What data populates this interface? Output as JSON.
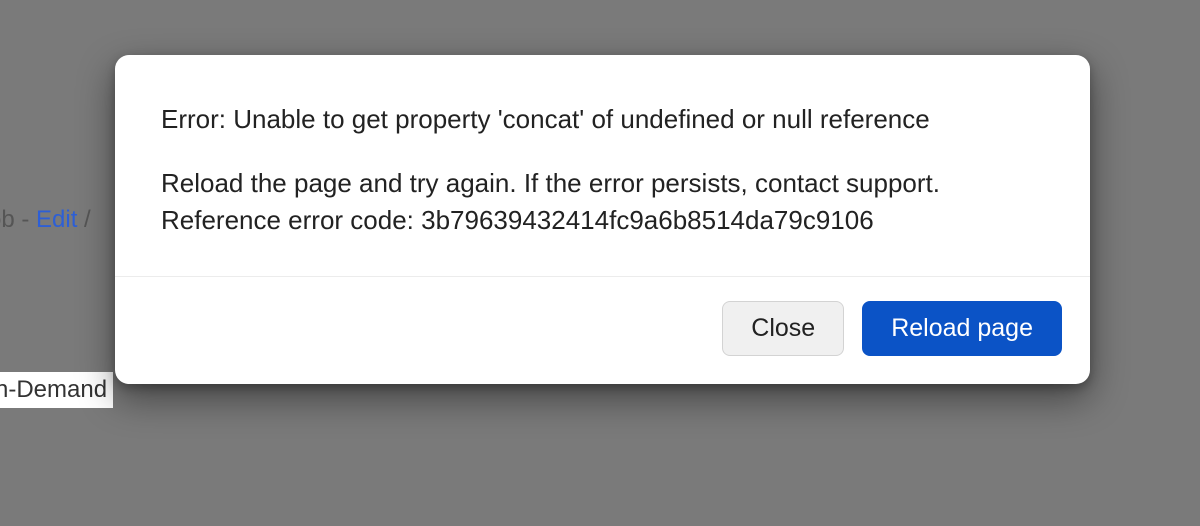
{
  "backdrop": {
    "breadcrumb_part1": "ob - ",
    "breadcrumb_link": "Edit",
    "breadcrumb_part2": " / ",
    "demand_text": "n-Demand"
  },
  "modal": {
    "title": "Error: Unable to get property 'concat' of undefined or null reference",
    "instruction": "Reload the page and try again. If the error persists, contact support.",
    "reference_line": "Reference error code: 3b79639432414fc9a6b8514da79c9106",
    "close_label": "Close",
    "reload_label": "Reload page"
  }
}
